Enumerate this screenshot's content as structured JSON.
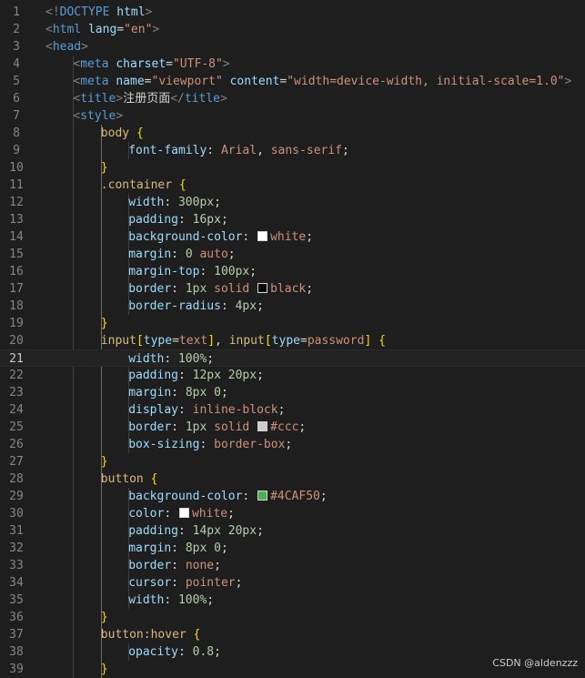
{
  "editor": {
    "active_line": 21,
    "lines": [
      {
        "n": "1",
        "tokens": [
          [
            "t-tag",
            "<!"
          ],
          [
            "t-doctype",
            "DOCTYPE"
          ],
          [
            "t-text",
            " "
          ],
          [
            "t-attr",
            "html"
          ],
          [
            "t-tag",
            ">"
          ]
        ]
      },
      {
        "n": "2",
        "tokens": [
          [
            "t-tag",
            "<"
          ],
          [
            "t-el",
            "html"
          ],
          [
            "t-text",
            " "
          ],
          [
            "t-attr",
            "lang"
          ],
          [
            "t-punc",
            "="
          ],
          [
            "t-str",
            "\"en\""
          ],
          [
            "t-tag",
            ">"
          ]
        ]
      },
      {
        "n": "3",
        "tokens": [
          [
            "t-tag",
            "<"
          ],
          [
            "t-el",
            "head"
          ],
          [
            "t-tag",
            ">"
          ]
        ]
      },
      {
        "n": "4",
        "indent": 4,
        "tokens": [
          [
            "t-tag",
            "<"
          ],
          [
            "t-el",
            "meta"
          ],
          [
            "t-text",
            " "
          ],
          [
            "t-attr",
            "charset"
          ],
          [
            "t-punc",
            "="
          ],
          [
            "t-str",
            "\"UTF-8\""
          ],
          [
            "t-tag",
            ">"
          ]
        ]
      },
      {
        "n": "5",
        "indent": 4,
        "tokens": [
          [
            "t-tag",
            "<"
          ],
          [
            "t-el",
            "meta"
          ],
          [
            "t-text",
            " "
          ],
          [
            "t-attr",
            "name"
          ],
          [
            "t-punc",
            "="
          ],
          [
            "t-str",
            "\"viewport\""
          ],
          [
            "t-text",
            " "
          ],
          [
            "t-attr",
            "content"
          ],
          [
            "t-punc",
            "="
          ],
          [
            "t-str",
            "\"width=device-width, initial-scale=1.0\""
          ],
          [
            "t-tag",
            ">"
          ]
        ]
      },
      {
        "n": "6",
        "indent": 4,
        "tokens": [
          [
            "t-tag",
            "<"
          ],
          [
            "t-el",
            "title"
          ],
          [
            "t-tag",
            ">"
          ],
          [
            "t-text",
            "注册页面"
          ],
          [
            "t-tag",
            "</"
          ],
          [
            "t-el",
            "title"
          ],
          [
            "t-tag",
            ">"
          ]
        ]
      },
      {
        "n": "7",
        "indent": 4,
        "tokens": [
          [
            "t-tag",
            "<"
          ],
          [
            "t-el",
            "style"
          ],
          [
            "t-tag",
            ">"
          ]
        ]
      },
      {
        "n": "8",
        "indent": 8,
        "tokens": [
          [
            "t-sel",
            "body"
          ],
          [
            "t-text",
            " "
          ],
          [
            "t-br",
            "{"
          ]
        ]
      },
      {
        "n": "9",
        "indent": 12,
        "tokens": [
          [
            "t-prop",
            "font-family"
          ],
          [
            "t-punc",
            ": "
          ],
          [
            "t-val",
            "Arial"
          ],
          [
            "t-punc",
            ", "
          ],
          [
            "t-val",
            "sans-serif"
          ],
          [
            "t-punc",
            ";"
          ]
        ]
      },
      {
        "n": "10",
        "indent": 8,
        "tokens": [
          [
            "t-br",
            "}"
          ]
        ]
      },
      {
        "n": "11",
        "indent": 8,
        "tokens": [
          [
            "t-sel",
            ".container"
          ],
          [
            "t-text",
            " "
          ],
          [
            "t-br",
            "{"
          ]
        ]
      },
      {
        "n": "12",
        "indent": 12,
        "tokens": [
          [
            "t-prop",
            "width"
          ],
          [
            "t-punc",
            ": "
          ],
          [
            "t-num",
            "300px"
          ],
          [
            "t-punc",
            ";"
          ]
        ]
      },
      {
        "n": "13",
        "indent": 12,
        "tokens": [
          [
            "t-prop",
            "padding"
          ],
          [
            "t-punc",
            ": "
          ],
          [
            "t-num",
            "16px"
          ],
          [
            "t-punc",
            ";"
          ]
        ]
      },
      {
        "n": "14",
        "indent": 12,
        "tokens": [
          [
            "t-prop",
            "background-color"
          ],
          [
            "t-punc",
            ": "
          ],
          [
            "swatch",
            "#ffffff"
          ],
          [
            "t-val",
            "white"
          ],
          [
            "t-punc",
            ";"
          ]
        ]
      },
      {
        "n": "15",
        "indent": 12,
        "tokens": [
          [
            "t-prop",
            "margin"
          ],
          [
            "t-punc",
            ": "
          ],
          [
            "t-num",
            "0"
          ],
          [
            "t-text",
            " "
          ],
          [
            "t-val",
            "auto"
          ],
          [
            "t-punc",
            ";"
          ]
        ]
      },
      {
        "n": "16",
        "indent": 12,
        "tokens": [
          [
            "t-prop",
            "margin-top"
          ],
          [
            "t-punc",
            ": "
          ],
          [
            "t-num",
            "100px"
          ],
          [
            "t-punc",
            ";"
          ]
        ]
      },
      {
        "n": "17",
        "indent": 12,
        "tokens": [
          [
            "t-prop",
            "border"
          ],
          [
            "t-punc",
            ": "
          ],
          [
            "t-num",
            "1px"
          ],
          [
            "t-text",
            " "
          ],
          [
            "t-val",
            "solid"
          ],
          [
            "t-text",
            " "
          ],
          [
            "swatch",
            "#000000"
          ],
          [
            "t-val",
            "black"
          ],
          [
            "t-punc",
            ";"
          ]
        ]
      },
      {
        "n": "18",
        "indent": 12,
        "tokens": [
          [
            "t-prop",
            "border-radius"
          ],
          [
            "t-punc",
            ": "
          ],
          [
            "t-num",
            "4px"
          ],
          [
            "t-punc",
            ";"
          ]
        ]
      },
      {
        "n": "19",
        "indent": 8,
        "tokens": [
          [
            "t-br",
            "}"
          ]
        ]
      },
      {
        "n": "20",
        "indent": 8,
        "tokens": [
          [
            "t-sel",
            "input"
          ],
          [
            "t-br",
            "["
          ],
          [
            "t-attr",
            "type"
          ],
          [
            "t-punc",
            "="
          ],
          [
            "t-val",
            "text"
          ],
          [
            "t-br",
            "]"
          ],
          [
            "t-punc",
            ", "
          ],
          [
            "t-sel",
            "input"
          ],
          [
            "t-br",
            "["
          ],
          [
            "t-attr",
            "type"
          ],
          [
            "t-punc",
            "="
          ],
          [
            "t-val",
            "password"
          ],
          [
            "t-br",
            "]"
          ],
          [
            "t-text",
            " "
          ],
          [
            "t-br",
            "{"
          ]
        ]
      },
      {
        "n": "21",
        "indent": 12,
        "tokens": [
          [
            "t-prop",
            "width"
          ],
          [
            "t-punc",
            ": "
          ],
          [
            "t-num",
            "100%"
          ],
          [
            "t-punc",
            ";"
          ]
        ]
      },
      {
        "n": "22",
        "indent": 12,
        "tokens": [
          [
            "t-prop",
            "padding"
          ],
          [
            "t-punc",
            ": "
          ],
          [
            "t-num",
            "12px"
          ],
          [
            "t-text",
            " "
          ],
          [
            "t-num",
            "20px"
          ],
          [
            "t-punc",
            ";"
          ]
        ]
      },
      {
        "n": "23",
        "indent": 12,
        "tokens": [
          [
            "t-prop",
            "margin"
          ],
          [
            "t-punc",
            ": "
          ],
          [
            "t-num",
            "8px"
          ],
          [
            "t-text",
            " "
          ],
          [
            "t-num",
            "0"
          ],
          [
            "t-punc",
            ";"
          ]
        ]
      },
      {
        "n": "24",
        "indent": 12,
        "tokens": [
          [
            "t-prop",
            "display"
          ],
          [
            "t-punc",
            ": "
          ],
          [
            "t-val",
            "inline-block"
          ],
          [
            "t-punc",
            ";"
          ]
        ]
      },
      {
        "n": "25",
        "indent": 12,
        "tokens": [
          [
            "t-prop",
            "border"
          ],
          [
            "t-punc",
            ": "
          ],
          [
            "t-num",
            "1px"
          ],
          [
            "t-text",
            " "
          ],
          [
            "t-val",
            "solid"
          ],
          [
            "t-text",
            " "
          ],
          [
            "swatch",
            "#cccccc"
          ],
          [
            "t-val",
            "#ccc"
          ],
          [
            "t-punc",
            ";"
          ]
        ]
      },
      {
        "n": "26",
        "indent": 12,
        "tokens": [
          [
            "t-prop",
            "box-sizing"
          ],
          [
            "t-punc",
            ": "
          ],
          [
            "t-val",
            "border-box"
          ],
          [
            "t-punc",
            ";"
          ]
        ]
      },
      {
        "n": "27",
        "indent": 8,
        "tokens": [
          [
            "t-br",
            "}"
          ]
        ]
      },
      {
        "n": "28",
        "indent": 8,
        "tokens": [
          [
            "t-sel",
            "button"
          ],
          [
            "t-text",
            " "
          ],
          [
            "t-br",
            "{"
          ]
        ]
      },
      {
        "n": "29",
        "indent": 12,
        "tokens": [
          [
            "t-prop",
            "background-color"
          ],
          [
            "t-punc",
            ": "
          ],
          [
            "swatch",
            "#4CAF50"
          ],
          [
            "t-val",
            "#4CAF50"
          ],
          [
            "t-punc",
            ";"
          ]
        ]
      },
      {
        "n": "30",
        "indent": 12,
        "tokens": [
          [
            "t-prop",
            "color"
          ],
          [
            "t-punc",
            ": "
          ],
          [
            "swatch",
            "#ffffff"
          ],
          [
            "t-val",
            "white"
          ],
          [
            "t-punc",
            ";"
          ]
        ]
      },
      {
        "n": "31",
        "indent": 12,
        "tokens": [
          [
            "t-prop",
            "padding"
          ],
          [
            "t-punc",
            ": "
          ],
          [
            "t-num",
            "14px"
          ],
          [
            "t-text",
            " "
          ],
          [
            "t-num",
            "20px"
          ],
          [
            "t-punc",
            ";"
          ]
        ]
      },
      {
        "n": "32",
        "indent": 12,
        "tokens": [
          [
            "t-prop",
            "margin"
          ],
          [
            "t-punc",
            ": "
          ],
          [
            "t-num",
            "8px"
          ],
          [
            "t-text",
            " "
          ],
          [
            "t-num",
            "0"
          ],
          [
            "t-punc",
            ";"
          ]
        ]
      },
      {
        "n": "33",
        "indent": 12,
        "tokens": [
          [
            "t-prop",
            "border"
          ],
          [
            "t-punc",
            ": "
          ],
          [
            "t-val",
            "none"
          ],
          [
            "t-punc",
            ";"
          ]
        ]
      },
      {
        "n": "34",
        "indent": 12,
        "tokens": [
          [
            "t-prop",
            "cursor"
          ],
          [
            "t-punc",
            ": "
          ],
          [
            "t-val",
            "pointer"
          ],
          [
            "t-punc",
            ";"
          ]
        ]
      },
      {
        "n": "35",
        "indent": 12,
        "tokens": [
          [
            "t-prop",
            "width"
          ],
          [
            "t-punc",
            ": "
          ],
          [
            "t-num",
            "100%"
          ],
          [
            "t-punc",
            ";"
          ]
        ]
      },
      {
        "n": "36",
        "indent": 8,
        "tokens": [
          [
            "t-br",
            "}"
          ]
        ]
      },
      {
        "n": "37",
        "indent": 8,
        "tokens": [
          [
            "t-sel",
            "button:hover"
          ],
          [
            "t-text",
            " "
          ],
          [
            "t-br",
            "{"
          ]
        ]
      },
      {
        "n": "38",
        "indent": 12,
        "tokens": [
          [
            "t-prop",
            "opacity"
          ],
          [
            "t-punc",
            ": "
          ],
          [
            "t-num",
            "0.8"
          ],
          [
            "t-punc",
            ";"
          ]
        ]
      },
      {
        "n": "39",
        "indent": 8,
        "tokens": [
          [
            "t-br",
            "}"
          ]
        ]
      }
    ]
  },
  "watermark": "CSDN @aldenzzz"
}
